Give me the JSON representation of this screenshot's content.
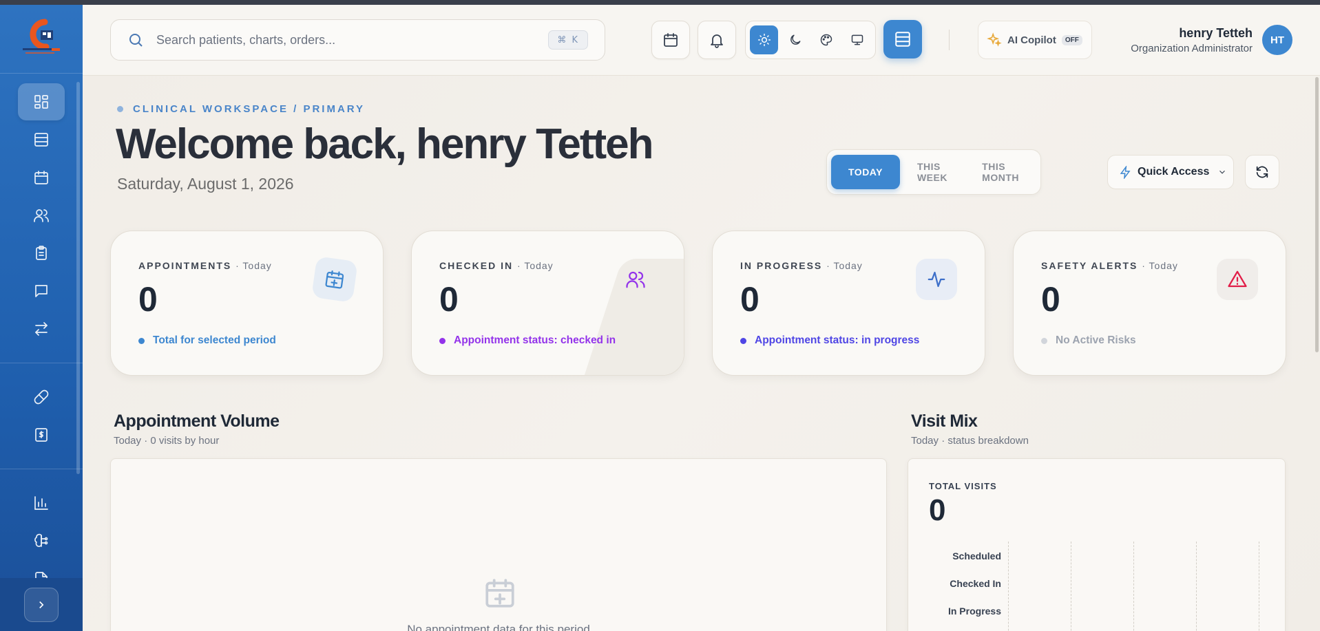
{
  "app": {
    "logo_label": "AmeriaHealth"
  },
  "header": {
    "search_placeholder": "Search patients, charts, orders...",
    "search_shortcut": "⌘ K",
    "copilot_label": "AI Copilot",
    "copilot_status": "OFF",
    "user_name": "henry Tetteh",
    "user_role": "Organization Administrator",
    "user_initials": "HT"
  },
  "sidebar": {
    "items": [
      {
        "icon": "dashboard-icon",
        "active": true
      },
      {
        "icon": "list-icon"
      },
      {
        "icon": "calendar-icon"
      },
      {
        "icon": "users-icon"
      },
      {
        "icon": "clipboard-icon"
      },
      {
        "icon": "chat-icon"
      },
      {
        "icon": "transfer-icon"
      },
      {
        "icon": "pill-icon"
      },
      {
        "icon": "billing-icon"
      },
      {
        "icon": "analytics-icon"
      },
      {
        "icon": "brain-icon"
      },
      {
        "icon": "document-icon"
      }
    ]
  },
  "page": {
    "breadcrumb": "CLINICAL WORKSPACE / PRIMARY",
    "title": "Welcome back, henry Tetteh",
    "date": "Saturday, August 1, 2026",
    "periods": [
      "TODAY",
      "THIS WEEK",
      "THIS MONTH"
    ],
    "active_period": "TODAY",
    "quick_access_label": "Quick Access"
  },
  "stats": [
    {
      "label": "APPOINTMENTS",
      "period": "· Today",
      "value": "0",
      "note": "Total for selected period",
      "color": "#3d87d0",
      "icon": "calendar-plus-icon"
    },
    {
      "label": "CHECKED IN",
      "period": "· Today",
      "value": "0",
      "note": "Appointment status: checked in",
      "color": "#9333ea",
      "icon": "users-icon"
    },
    {
      "label": "IN PROGRESS",
      "period": "· Today",
      "value": "0",
      "note": "Appointment status: in progress",
      "color": "#4f46e5",
      "icon": "activity-icon"
    },
    {
      "label": "SAFETY ALERTS",
      "period": "· Today",
      "value": "0",
      "note": "No Active Risks",
      "color": "#9ca3af",
      "icon": "alert-triangle-icon"
    }
  ],
  "volume": {
    "title": "Appointment Volume",
    "subtitle": "Today · 0 visits by hour",
    "empty_text": "No appointment data for this period"
  },
  "visit_mix": {
    "title": "Visit Mix",
    "subtitle": "Today · status breakdown",
    "total_label": "TOTAL VISITS",
    "total_value": "0",
    "rows": [
      "Scheduled",
      "Checked In",
      "In Progress"
    ]
  },
  "colors": {
    "accent": "#3d87d0",
    "sidebar": "#2e73c0",
    "checked_in": "#9333ea",
    "in_progress": "#4f46e5",
    "alert": "#e11d48"
  }
}
